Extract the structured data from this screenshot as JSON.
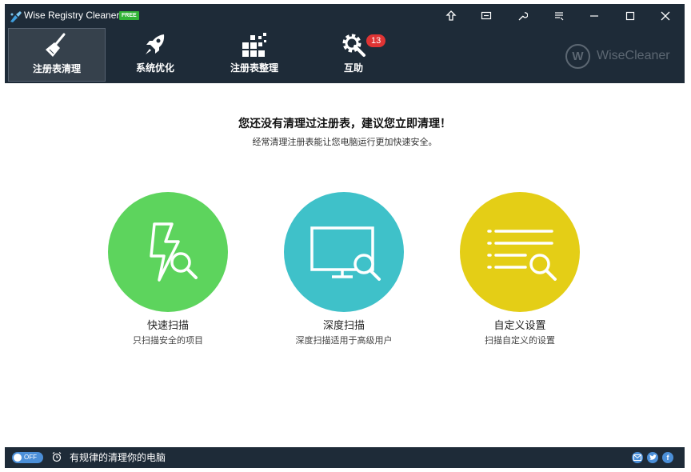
{
  "app": {
    "title": "Wise Registry Cleaner 9",
    "badge": "FREE"
  },
  "titlebar_icons": [
    "upgrade-icon",
    "feedback-icon",
    "tools-icon",
    "menu-icon",
    "minimize-icon",
    "maximize-icon",
    "close-icon"
  ],
  "nav": {
    "tabs": [
      {
        "label": "注册表清理",
        "icon": "broom-icon",
        "active": true
      },
      {
        "label": "系统优化",
        "icon": "rocket-icon",
        "active": false
      },
      {
        "label": "注册表整理",
        "icon": "blocks-icon",
        "active": false
      },
      {
        "label": "互助",
        "icon": "gear-wrench-icon",
        "active": false,
        "badge": "13"
      }
    ]
  },
  "brand": {
    "letter": "W",
    "name": "WiseCleaner"
  },
  "main": {
    "headline": "您还没有清理过注册表，建议您立即清理！",
    "subline": "经常清理注册表能让您电脑运行更加快速安全。",
    "options": [
      {
        "title": "快速扫描",
        "subtitle": "只扫描安全的项目",
        "color": "#5dd45d",
        "icon": "lightning-search-icon"
      },
      {
        "title": "深度扫描",
        "subtitle": "深度扫描适用于高级用户",
        "color": "#3fc1c9",
        "icon": "monitor-search-icon"
      },
      {
        "title": "自定义设置",
        "subtitle": "扫描自定义的设置",
        "color": "#e4ce16",
        "icon": "list-search-icon"
      }
    ]
  },
  "status": {
    "toggle": "OFF",
    "text": "有规律的清理你的电脑",
    "social": [
      "mail-icon",
      "twitter-icon",
      "facebook-icon"
    ]
  }
}
